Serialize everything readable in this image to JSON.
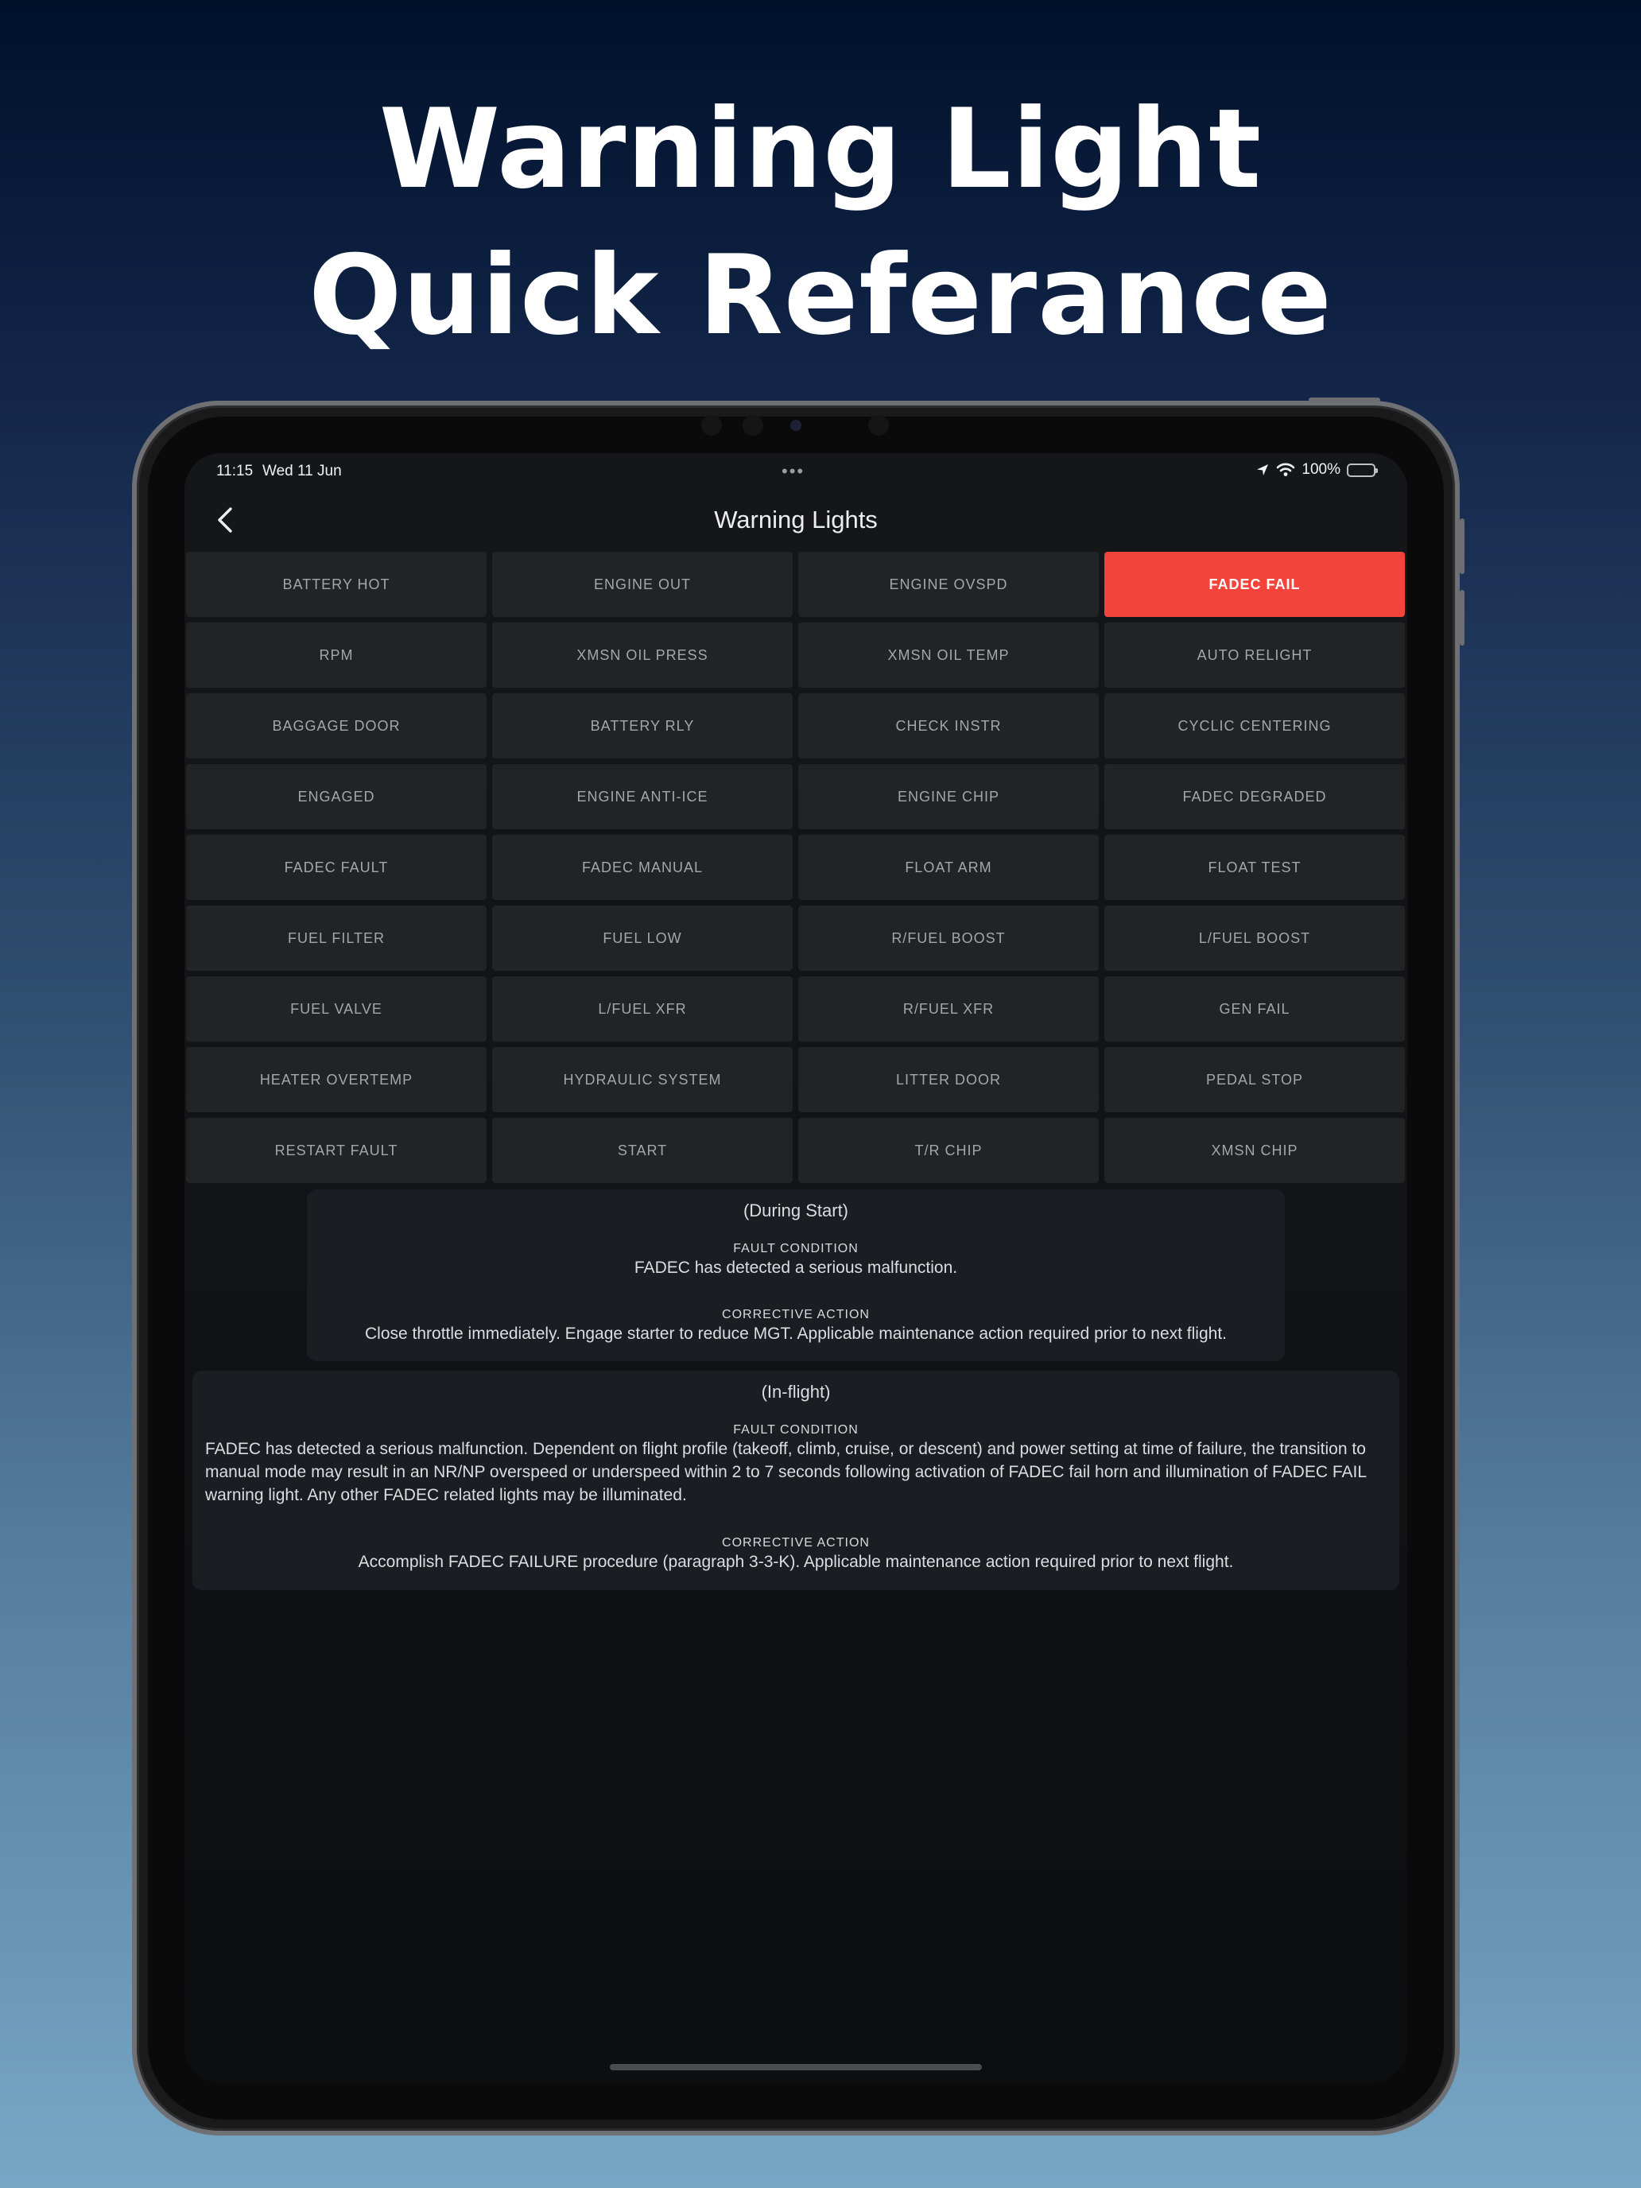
{
  "headline": {
    "line1": "Warning Light",
    "line2": "Quick Referance"
  },
  "status_bar": {
    "time": "11:15",
    "date": "Wed 11 Jun",
    "battery": "100%",
    "battery_level": 1.0,
    "icons": [
      "location-arrow-icon",
      "wifi-icon",
      "battery-icon"
    ]
  },
  "nav": {
    "title": "Warning Lights",
    "back_icon": "chevron-left-icon"
  },
  "colors": {
    "active": "#f3433a",
    "cell": "#222324",
    "card": "#1a1d21"
  },
  "lights": [
    "BATTERY HOT",
    "ENGINE OUT",
    "ENGINE OVSPD",
    "FADEC FAIL",
    "RPM",
    "XMSN OIL PRESS",
    "XMSN OIL TEMP",
    "AUTO RELIGHT",
    "BAGGAGE DOOR",
    "BATTERY RLY",
    "CHECK INSTR",
    "CYCLIC CENTERING",
    "ENGAGED",
    "ENGINE ANTI-ICE",
    "ENGINE CHIP",
    "FADEC DEGRADED",
    "FADEC FAULT",
    "FADEC MANUAL",
    "FLOAT ARM",
    "FLOAT TEST",
    "FUEL FILTER",
    "FUEL LOW",
    "R/FUEL BOOST",
    "L/FUEL BOOST",
    "FUEL VALVE",
    "L/FUEL XFR",
    "R/FUEL XFR",
    "GEN FAIL",
    "HEATER OVERTEMP",
    "HYDRAULIC SYSTEM",
    "LITTER DOOR",
    "PEDAL STOP",
    "RESTART FAULT",
    "START",
    "T/R CHIP",
    "XMSN CHIP"
  ],
  "selected_light": "FADEC FAIL",
  "cards": [
    {
      "phase": "(During Start)",
      "fault_label": "FAULT CONDITION",
      "fault_text": "FADEC has detected a serious malfunction.",
      "action_label": "CORRECTIVE ACTION",
      "action_text": "Close throttle immediately. Engage starter to reduce MGT. Applicable maintenance action required prior to next flight."
    },
    {
      "phase": "(In-flight)",
      "fault_label": "FAULT CONDITION",
      "fault_text": "FADEC has detected a serious malfunction. Dependent on flight profile (takeoff, climb, cruise, or descent) and power setting at time of failure, the transition to manual mode may result in an NR/NP overspeed or underspeed within 2 to 7 seconds following activation of FADEC fail horn and illumination of FADEC FAIL warning light. Any other FADEC related lights may be illuminated.",
      "action_label": "CORRECTIVE ACTION",
      "action_text": "Accomplish FADEC FAILURE procedure (paragraph 3-3-K). Applicable maintenance action required prior to next flight."
    }
  ]
}
